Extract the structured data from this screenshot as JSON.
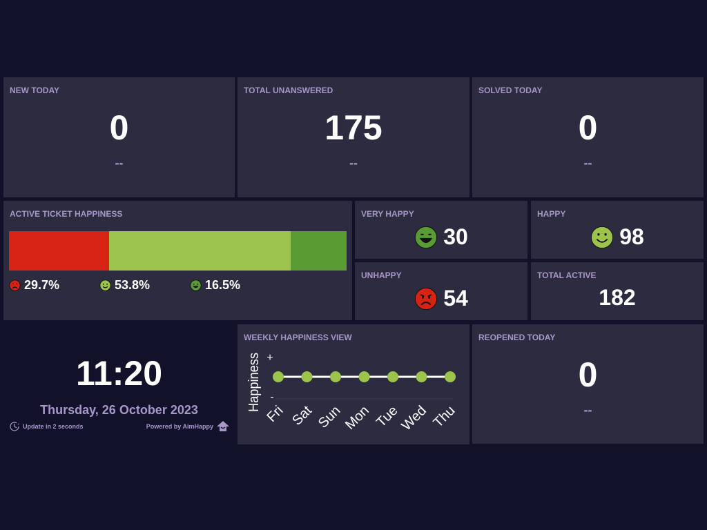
{
  "colors": {
    "background": "#11112a",
    "panel": "#2c2b40",
    "label": "#a898c9",
    "unhappy": "#d72314",
    "happy": "#9cc34c",
    "very_happy": "#5a9c33"
  },
  "new_today": {
    "title": "NEW TODAY",
    "value": "0",
    "delta": "--"
  },
  "total_unanswered": {
    "title": "TOTAL UNANSWERED",
    "value": "175",
    "delta": "--"
  },
  "solved_today": {
    "title": "SOLVED TODAY",
    "value": "0",
    "delta": "--"
  },
  "active_happiness": {
    "title": "ACTIVE TICKET HAPPINESS",
    "segments": [
      {
        "name": "unhappy",
        "percent": 29.7,
        "label": "29.7%",
        "icon": "unhappy-face-icon"
      },
      {
        "name": "happy",
        "percent": 53.8,
        "label": "53.8%",
        "icon": "happy-face-icon"
      },
      {
        "name": "very_happy",
        "percent": 16.5,
        "label": "16.5%",
        "icon": "very-happy-face-icon"
      }
    ]
  },
  "very_happy": {
    "title": "VERY HAPPY",
    "value": "30",
    "icon": "very-happy-face-icon"
  },
  "happy": {
    "title": "HAPPY",
    "value": "98",
    "icon": "happy-face-icon"
  },
  "unhappy": {
    "title": "UNHAPPY",
    "value": "54",
    "icon": "angry-face-icon"
  },
  "total_active": {
    "title": "TOTAL ACTIVE",
    "value": "182"
  },
  "clock": {
    "time": "11:20",
    "date": "Thursday, 26 October 2023",
    "update": "Update in 2 seconds",
    "powered": "Powered by AimHappy",
    "icons": [
      "clock-icon",
      "aimhappy-logo-icon"
    ]
  },
  "weekly": {
    "title": "WEEKLY HAPPINESS VIEW",
    "chart_data": {
      "type": "line",
      "title": "WEEKLY HAPPINESS VIEW",
      "ylabel": "Happiness",
      "xlabel": "",
      "y_tick_labels": [
        "+",
        "-"
      ],
      "categories": [
        "Fri",
        "Sat",
        "Sun",
        "Mon",
        "Tue",
        "Wed",
        "Thu"
      ],
      "values": [
        0.5,
        0.5,
        0.5,
        0.5,
        0.5,
        0.5,
        0.5
      ],
      "ylim": [
        0,
        1
      ],
      "grid": false
    }
  },
  "reopened_today": {
    "title": "REOPENED TODAY",
    "value": "0",
    "delta": "--"
  }
}
